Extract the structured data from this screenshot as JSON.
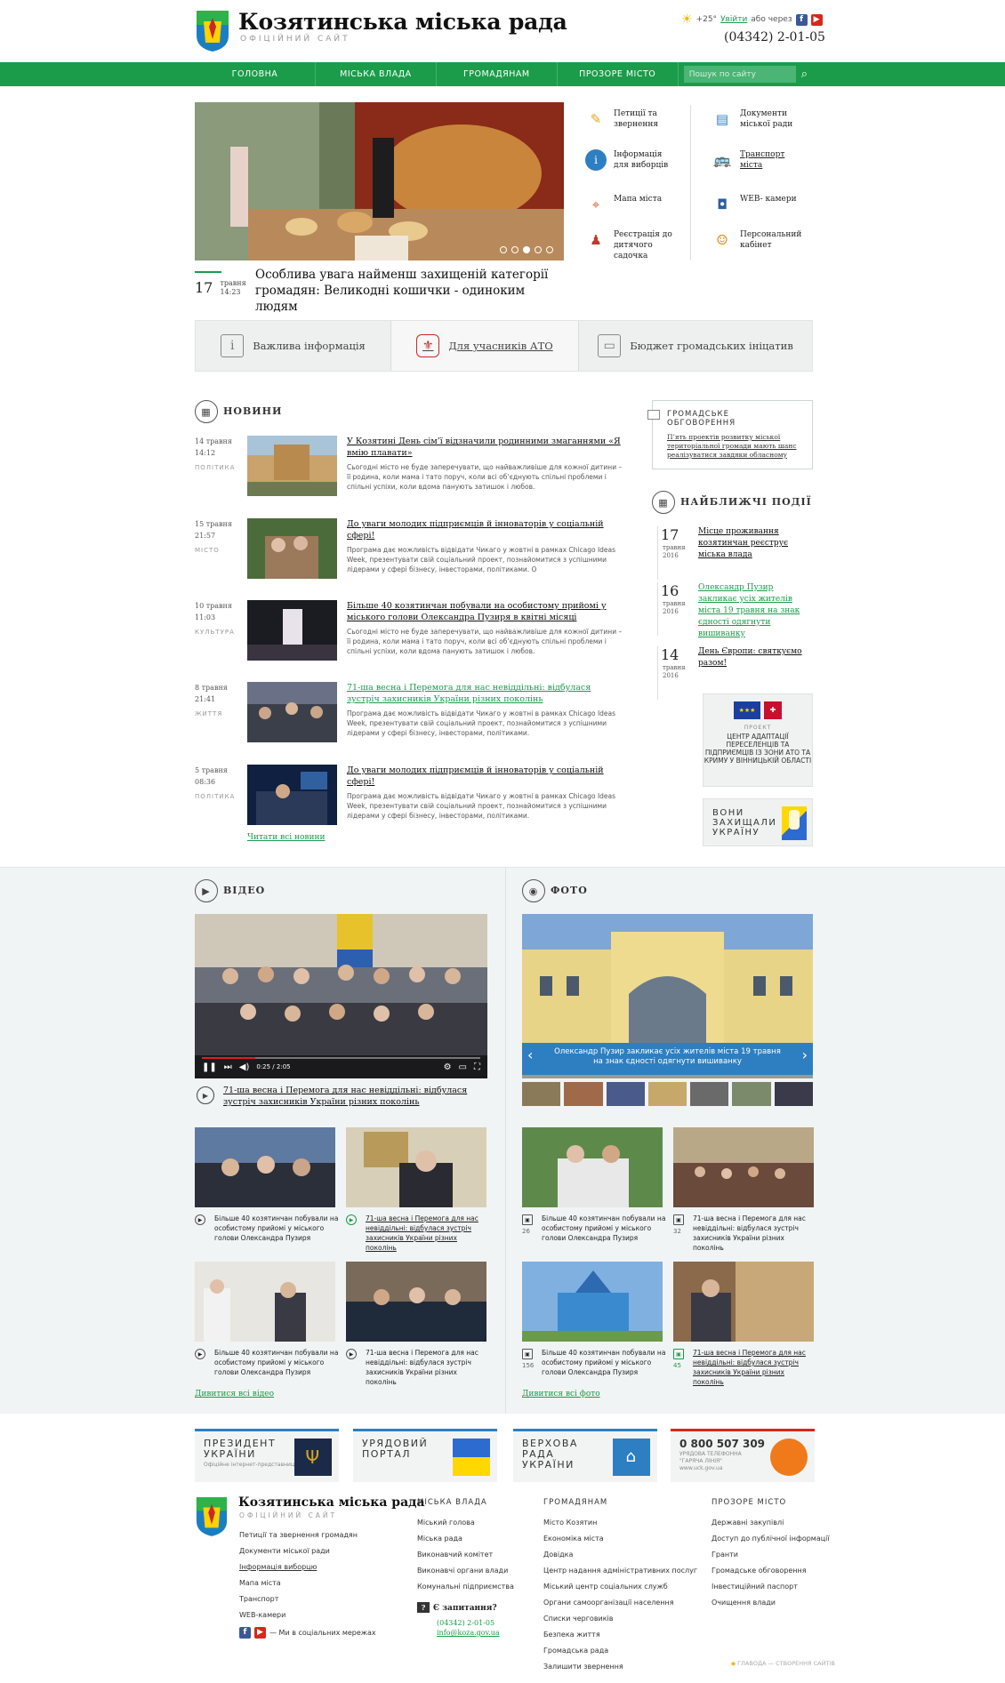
{
  "header": {
    "title": "Козятинська міська рада",
    "subtitle": "ОФІЦІЙНИЙ САЙТ",
    "weather": "+25°",
    "login_label": "Увійти",
    "login_via": "або через",
    "phone": "(04342) 2-01-05"
  },
  "nav": {
    "items": [
      "ГОЛОВНА",
      "МІСЬКА ВЛАДА",
      "ГРОМАДЯНАМ",
      "ПРОЗОРЕ МІСТО"
    ],
    "search_placeholder": "Пошук по сайту"
  },
  "hero": {
    "day": "17",
    "month": "травня",
    "time": "14:23",
    "title": "Особлива увага найменш захищеній категорії громадян: Великодні кошички - одиноким людям"
  },
  "quick_links": [
    {
      "label": "Петиції та звернення",
      "icon": "pen-icon"
    },
    {
      "label": "Документи міської ради",
      "icon": "document-icon"
    },
    {
      "label": "Інформація для виборців",
      "icon": "info-icon"
    },
    {
      "label": "Транспорт міста",
      "icon": "bus-icon"
    },
    {
      "label": "Мапа міста",
      "icon": "map-icon"
    },
    {
      "label": "WEB- камери",
      "icon": "camera-icon"
    },
    {
      "label": "Реєстрація до дитячого садочка",
      "icon": "stroller-icon"
    },
    {
      "label": "Персональний кабінет",
      "icon": "user-icon"
    }
  ],
  "tabs": [
    {
      "label": "Важлива інформація",
      "icon": "info-box-icon"
    },
    {
      "label": "Для учасників АТО",
      "icon": "shield-icon"
    },
    {
      "label": "Бюджет громадських ініцатив",
      "icon": "briefcase-icon"
    }
  ],
  "news": {
    "heading": "НОВИНИ",
    "items": [
      {
        "date": "14 травня",
        "time": "14:12",
        "cat": "ПОЛІТИКА",
        "title": "У Козятині День сім’ї відзначили родинними змаганнями «Я вмію плавати»",
        "text": "Сьогодні місто не буде заперечувати, що найважливіше для кожної дитини – її родина, коли мама і тато поруч, коли всі об’єднують спільні проблеми і спільні успіхи, коли вдома панують затишок і любов."
      },
      {
        "date": "15 травня",
        "time": "21:57",
        "cat": "МІСТО",
        "title": "До уваги молодих підприємців й інноваторів у соціальній сфері!",
        "text": "Програма дає можливість відвідати Чикаго у жовтні в рамках Chicago Ideas Week, презентувати свій соціальний проект, познайомитися з успішними лідерами у сфері бізнесу, інвесторами, політиками. О"
      },
      {
        "date": "10 травня",
        "time": "11:03",
        "cat": "КУЛЬТУРА",
        "title": "Більше 40 козятинчан побували на особистому прийомі у міського голови Олександра Пузиря в квітні місяці",
        "text": "Сьогодні місто не буде заперечувати, що найважливіше для кожної дитини – її родина, коли мама і тато поруч, коли всі об’єднують спільні проблеми і спільні успіхи, коли вдома панують затишок і любов."
      },
      {
        "date": "8 травня",
        "time": "21:41",
        "cat": "ЖИТТЯ",
        "title": "71-ша весна і Перемога для нас невіддільні: відбулася зустріч захисників України різних поколінь",
        "text": "Програма дає можливість відвідати Чикаго у жовтні в рамках Chicago Ideas Week, презентувати свій соціальний проект, познайомитися з успішними лідерами у сфері бізнесу, інвесторами, політиками."
      },
      {
        "date": "5 травня",
        "time": "08:36",
        "cat": "ПОЛІТИКА",
        "title": "До уваги молодих підприємців й інноваторів у соціальній сфері!",
        "text": "Програма дає можливість відвідати Чикаго у жовтні в рамках Chicago Ideas Week, презентувати свій соціальний проект, познайомитися з успішними лідерами у сфері бізнесу, інвесторами, політиками."
      }
    ],
    "read_all": "Читати всі новини"
  },
  "discussion": {
    "heading": "ГРОМАДСЬКЕ ОБГОВОРЕННЯ",
    "text": "П’ять проектів розвитку міської територіальної громади мають шанс реалізуватися завдяки обласному"
  },
  "events": {
    "heading": "НАЙБЛИЖЧІ ПОДІЇ",
    "items": [
      {
        "day": "17",
        "month": "травня",
        "year": "2016",
        "title": "Місце проживання козятинчан реєструє міська влада"
      },
      {
        "day": "16",
        "month": "травня",
        "year": "2016",
        "title": "Олександр Пузир закликає усіх жителів міста 19 травня на знак єдності одягнути вишиванку"
      },
      {
        "day": "14",
        "month": "травня",
        "year": "2016",
        "title": "День Європи: святкуємо разом!"
      }
    ]
  },
  "project": {
    "label": "ПРОЕКТ",
    "text": "ЦЕНТР АДАПТАЦІЇ ПЕРЕСЕЛЕНЦІВ ТА ПІДПРИЄМЦІВ ІЗ ЗОНИ АТО ТА КРИМУ У ВІННИЦЬКІЙ ОБЛАСТІ"
  },
  "defend": {
    "text": "ВОНИ ЗАХИЩАЛИ УКРАЇНУ"
  },
  "video": {
    "heading": "ВІДЕО",
    "time": "0:25 / 2:05",
    "caption": "71-ша весна і Перемога для нас невіддільні: відбулася зустріч захисників України різних поколінь",
    "cards": [
      {
        "title": "Більше 40 козятинчан побували на особистому прийомі у міського голови Олександра Пузиря"
      },
      {
        "title": "71-ша весна і Перемога для нас невіддільні: відбулася зустріч захисників України різних поколінь"
      },
      {
        "title": "Більше 40 козятинчан побували на особистому прийомі у міського голови Олександра Пузиря"
      },
      {
        "title": "71-ша весна і Перемога для нас невіддільні: відбулася зустріч захисників України різних поколінь"
      }
    ],
    "see_all": "Дивитися всі відео"
  },
  "photo": {
    "heading": "ФОТО",
    "caption": "Олександр Пузир закликає усіх жителів міста 19 травня на знак єдності одягнути вишиванку",
    "cards": [
      {
        "title": "Більше 40 козятинчан побували на особистому прийомі у міського голови Олександра Пузиря",
        "count": "26"
      },
      {
        "title": "71-ша весна і Перемога для нас невіддільні: відбулася зустріч захисників України різних поколінь",
        "count": "32"
      },
      {
        "title": "Більше 40 козятинчан побували на особистому прийомі у міського голови Олександра Пузиря",
        "count": "156"
      },
      {
        "title": "71-ша весна і Перемога для нас невіддільні: відбулася зустріч захисників України різних поколінь",
        "count": "45"
      }
    ],
    "see_all": "Дивитися всі фото"
  },
  "banners": [
    {
      "title": "ПРЕЗИДЕНТ УКРАЇНИ",
      "sub": "Офіційне інтернет-представництво"
    },
    {
      "title": "УРЯДОВИЙ ПОРТАЛ",
      "sub": ""
    },
    {
      "title": "ВЕРХОВА РАДА УКРАЇНИ",
      "sub": ""
    },
    {
      "title": "0 800 507 309",
      "sub": "УРЯДОВА ТЕЛЕФОННА \"ГАРЯЧА ЛІНІЯ\" www.uck.gov.ua"
    }
  ],
  "footer": {
    "title": "Козятинська міська рада",
    "subtitle": "ОФІЦІЙНИЙ САЙТ",
    "links": [
      "Петиції та звернення громадян",
      "Документи міської ради",
      "Інформація виборцю",
      "Мапа міста",
      "Транспорт",
      "WEB-камери"
    ],
    "social": "— Ми в соціальних мережах",
    "col1_head": "МІСЬКА ВЛАДА",
    "col1": [
      "Міський голова",
      "Міська рада",
      "Виконавчий комітет",
      "Виконавчі органи влади",
      "Комунальні підприємства"
    ],
    "col2_head": "ГРОМАДЯНАМ",
    "col2": [
      "Місто Козятин",
      "Економіка міста",
      "Довідка",
      "Центр надання адміністративних послуг",
      "Міський центр соціальних служб",
      "Органи самоорганізації населення",
      "Списки черговиків",
      "Безпека життя",
      "Громадська рада",
      "Залишити звернення"
    ],
    "col3_head": "ПРОЗОРЕ МІСТО",
    "col3": [
      "Державні закупівлі",
      "Доступ до публічної інформації",
      "Гранти",
      "Громадське обговорення",
      "Інвестиційний паспорт",
      "Очищення влади"
    ],
    "ask": "Є запитання?",
    "ask_phone": "(04342) 2-01-05",
    "ask_email": "info@koza.gov.ua",
    "credit": "ГЛАВОДА — СТВОРЕННЯ САЙТІВ"
  }
}
